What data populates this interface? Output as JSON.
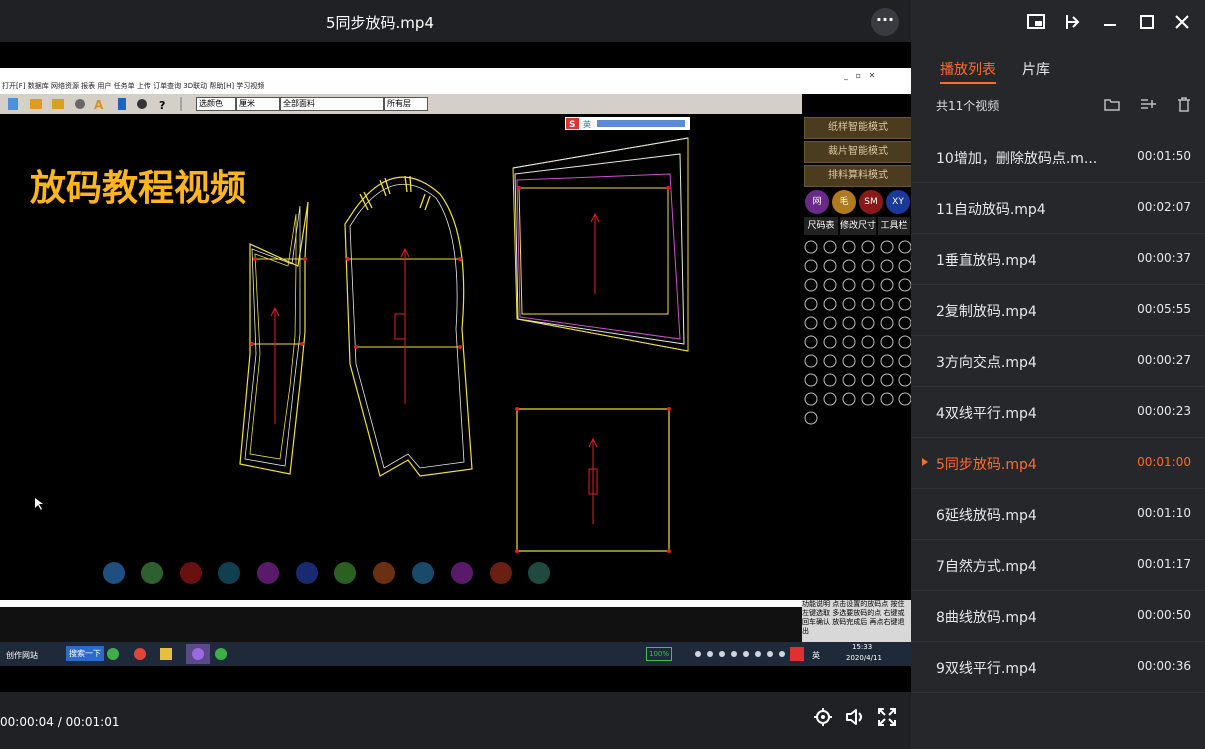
{
  "window": {
    "title": "5同步放码.mp4"
  },
  "video_overlay": {
    "title": "放码教程视频"
  },
  "cad": {
    "menu": "打开[F] 数据库 网络资源 报表 用户 任务单 上传 订单查询 3D联动 帮助[H] 学习视频",
    "toolbar": {
      "color_select": "选颜色",
      "size_select": "厘米",
      "fabric_select": "全部面料",
      "layer_select": "所有层"
    },
    "modes": [
      "纸样智能模式",
      "裁片智能模式",
      "排料算料模式"
    ],
    "round_buttons": [
      "网",
      "毛",
      "SM",
      "XY"
    ],
    "sub_tabs": [
      "尺码表",
      "修改尺寸",
      "工具栏"
    ],
    "help_text": "功能说明 点击设置的放码点 按住左键选取 多选要放码的点 右键或回车确认 放码完成后 再点右键退出"
  },
  "taskbar": {
    "left_text": "创作网站",
    "search_text": "搜索一下",
    "battery": "100%",
    "time": "15:33",
    "date": "2020/4/11",
    "ime": "英"
  },
  "controls": {
    "time": "00:00:04 / 00:01:01"
  },
  "sidebar": {
    "tabs": [
      {
        "label": "播放列表",
        "active": true
      },
      {
        "label": "片库",
        "active": false
      }
    ],
    "count": "共11个视频",
    "playlist": [
      {
        "name": "10增加，删除放码点.m...",
        "duration": "00:01:50",
        "active": false
      },
      {
        "name": "11自动放码.mp4",
        "duration": "00:02:07",
        "active": false
      },
      {
        "name": "1垂直放码.mp4",
        "duration": "00:00:37",
        "active": false
      },
      {
        "name": "2复制放码.mp4",
        "duration": "00:05:55",
        "active": false
      },
      {
        "name": "3方向交点.mp4",
        "duration": "00:00:27",
        "active": false
      },
      {
        "name": "4双线平行.mp4",
        "duration": "00:00:23",
        "active": false
      },
      {
        "name": "5同步放码.mp4",
        "duration": "00:01:00",
        "active": true
      },
      {
        "name": "6延线放码.mp4",
        "duration": "00:01:10",
        "active": false
      },
      {
        "name": "7自然方式.mp4",
        "duration": "00:01:17",
        "active": false
      },
      {
        "name": "8曲线放码.mp4",
        "duration": "00:00:50",
        "active": false
      },
      {
        "name": "9双线平行.mp4",
        "duration": "00:00:36",
        "active": false
      }
    ]
  },
  "colors": {
    "accent": "#ff6a2d",
    "overlay_title": "#ffb61e",
    "pattern_yellow": "#f0e040",
    "pattern_red": "#e02020"
  }
}
